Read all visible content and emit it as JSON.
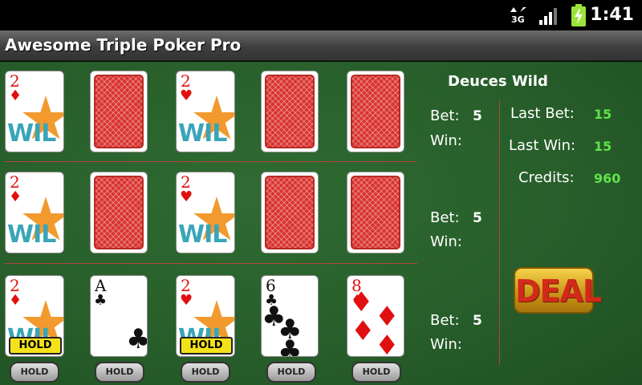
{
  "status_bar": {
    "time": "1:41",
    "network_label": "3G",
    "icons": [
      "data-arrows-icon",
      "signal-icon",
      "battery-charging-icon"
    ]
  },
  "app": {
    "title": "Awesome Triple Poker Pro"
  },
  "game": {
    "name": "Deuces Wild",
    "wild_text": "WIL",
    "hands": [
      {
        "bet_label": "Bet:",
        "bet": "5",
        "win_label": "Win:",
        "cards": [
          {
            "face": "up",
            "rank": "2",
            "suit": "♦",
            "color": "red",
            "wild": true
          },
          {
            "face": "down"
          },
          {
            "face": "up",
            "rank": "2",
            "suit": "♥",
            "color": "red",
            "wild": true
          },
          {
            "face": "down"
          },
          {
            "face": "down"
          }
        ]
      },
      {
        "bet_label": "Bet:",
        "bet": "5",
        "win_label": "Win:",
        "cards": [
          {
            "face": "up",
            "rank": "2",
            "suit": "♦",
            "color": "red",
            "wild": true
          },
          {
            "face": "down"
          },
          {
            "face": "up",
            "rank": "2",
            "suit": "♥",
            "color": "red",
            "wild": true
          },
          {
            "face": "down"
          },
          {
            "face": "down"
          }
        ]
      },
      {
        "bet_label": "Bet:",
        "bet": "5",
        "win_label": "Win:",
        "cards": [
          {
            "face": "up",
            "rank": "2",
            "suit": "♦",
            "color": "red",
            "wild": true,
            "held": true
          },
          {
            "face": "up",
            "rank": "A",
            "suit": "♣",
            "color": "black"
          },
          {
            "face": "up",
            "rank": "2",
            "suit": "♥",
            "color": "red",
            "wild": true,
            "held": true
          },
          {
            "face": "up",
            "rank": "6",
            "suit": "♣",
            "color": "black"
          },
          {
            "face": "up",
            "rank": "8",
            "suit": "♦",
            "color": "red"
          }
        ]
      }
    ],
    "hold_tag_label": "HOLD",
    "hold_buttons": [
      "HOLD",
      "HOLD",
      "HOLD",
      "HOLD",
      "HOLD"
    ],
    "stats": {
      "last_bet_label": "Last Bet:",
      "last_bet": "15",
      "last_win_label": "Last Win:",
      "last_win": "15",
      "credits_label": "Credits:",
      "credits": "960"
    },
    "deal_label": "DEAL"
  },
  "colors": {
    "felt": "#275d2a",
    "divider": "#b3453a",
    "value_green": "#5fe34b",
    "hold_yellow": "#f3e21a",
    "card_back_red": "#d9342f"
  }
}
